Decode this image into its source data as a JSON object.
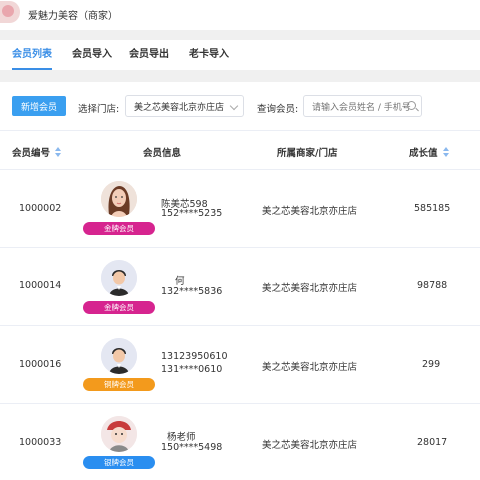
{
  "header": {
    "store_name": "爱魅力美容（商家）"
  },
  "tabs": [
    {
      "label": "会员列表",
      "active": true
    },
    {
      "label": "会员导入",
      "active": false
    },
    {
      "label": "会员导出",
      "active": false
    },
    {
      "label": "老卡导入",
      "active": false
    }
  ],
  "toolbar": {
    "add_button": "新增会员",
    "store_label": "选择门店:",
    "store_value": "美之芯美容北京亦庄店",
    "query_label": "查询会员:",
    "search_placeholder": "请输入会员姓名 / 手机号"
  },
  "table": {
    "columns": [
      "会员编号",
      "会员信息",
      "所属商家/门店",
      "成长值"
    ],
    "rows": [
      {
        "id": "1000002",
        "name": "陈美芯598",
        "phone": "152****5235",
        "level": "金牌会员",
        "level_color": "#d6248f",
        "avatar": "female-photo",
        "store": "美之芯美容北京亦庄店",
        "growth": "585185"
      },
      {
        "id": "1000014",
        "name": "何",
        "phone": "132****5836",
        "level": "金牌会员",
        "level_color": "#d6248f",
        "avatar": "default-avatar",
        "store": "美之芯美容北京亦庄店",
        "growth": "98788"
      },
      {
        "id": "1000016",
        "name": "13123950610",
        "phone": "131****0610",
        "level": "铜牌会员",
        "level_color": "#f39a1c",
        "avatar": "default-avatar",
        "store": "美之芯美容北京亦庄店",
        "growth": "299"
      },
      {
        "id": "1000033",
        "name": "杨老师",
        "phone": "150****5498",
        "level": "银牌会员",
        "level_color": "#2a8ef0",
        "avatar": "cartoon-photo",
        "store": "美之芯美容北京亦庄店",
        "growth": "28017"
      }
    ]
  }
}
